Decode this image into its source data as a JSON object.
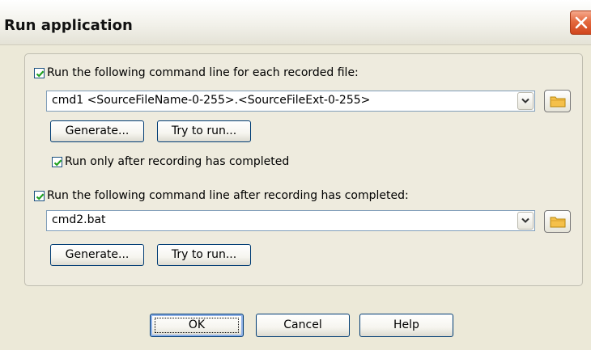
{
  "window": {
    "title": "Run application"
  },
  "section1": {
    "checkbox_label": "Run the following command line for each recorded file:",
    "checked": true,
    "command_value": "cmd1 <SourceFileName-0-255>.<SourceFileExt-0-255>",
    "generate_label": "Generate...",
    "try_label": "Try to run...",
    "sub_checkbox_label": "Run only after recording has completed",
    "sub_checked": true
  },
  "section2": {
    "checkbox_label": "Run the following command line after recording has completed:",
    "checked": true,
    "command_value": "cmd2.bat",
    "generate_label": "Generate...",
    "try_label": "Try to run..."
  },
  "footer": {
    "ok_label": "OK",
    "cancel_label": "Cancel",
    "help_label": "Help"
  },
  "icons": {
    "close": "close-icon",
    "dropdown": "chevron-down-icon",
    "browse": "folder-icon",
    "check": "check-icon"
  },
  "colors": {
    "title_bg": "#f2f1ea",
    "dialog_bg": "#ece9d8",
    "close_button": "#d9542b",
    "checkmark": "#21a121",
    "folder": "#f5c04a"
  }
}
